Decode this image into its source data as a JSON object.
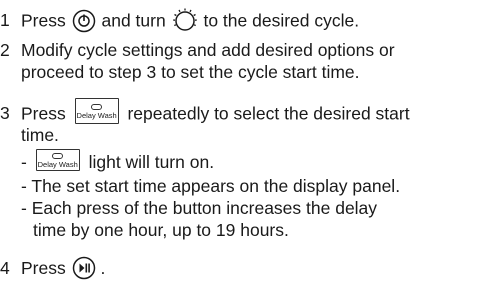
{
  "steps": [
    {
      "number": "1",
      "parts": {
        "a": "Press",
        "b": "and turn",
        "c": "to the desired cycle."
      }
    },
    {
      "number": "2",
      "lines": [
        "Modify cycle settings and add desired options or",
        "proceed to step 3 to set the cycle start time."
      ]
    },
    {
      "number": "3",
      "parts": {
        "a": "Press",
        "b": "repeatedly to select the desired start"
      },
      "line2": "time.",
      "bullets": {
        "first_prefix": "-",
        "first_suffix": "light will turn on.",
        "second": "- The set start time appears on the display panel.",
        "third_line1": "- Each press of the button increases the delay",
        "third_line2": "time by one hour, up to 19 hours."
      }
    },
    {
      "number": "4",
      "parts": {
        "a": "Press",
        "b": "."
      }
    }
  ],
  "icons": {
    "power": "power-icon",
    "dial": "cycle-selector-dial-icon",
    "delay": "delay-wash-button-icon",
    "start_pause": "start-pause-icon"
  },
  "delay_wash_label": "Delay Wash"
}
